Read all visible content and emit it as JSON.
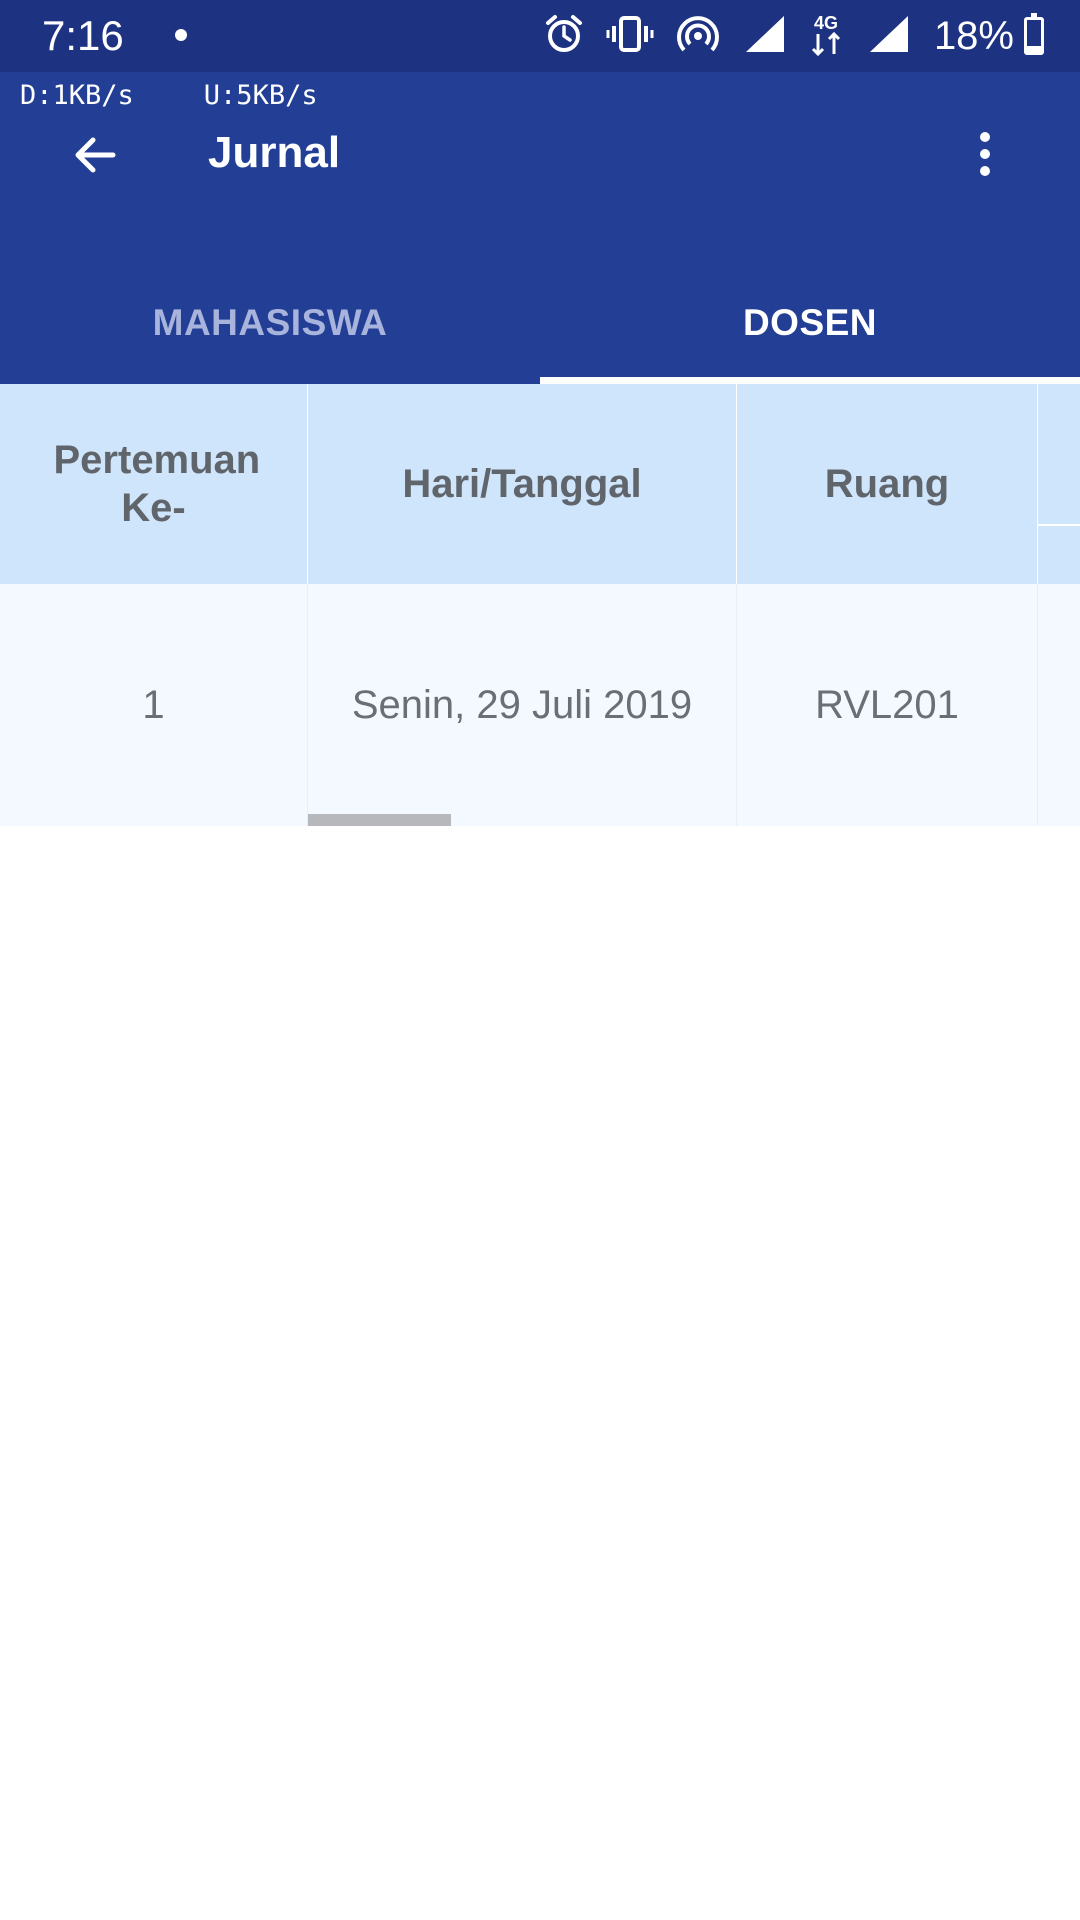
{
  "status_bar": {
    "time": "7:16",
    "network_type": "4G",
    "battery_percent_text": "18%",
    "battery_level": 0.18,
    "icons": [
      "alarm-icon",
      "vibrate-icon",
      "hotspot-icon",
      "signal-icon",
      "data-4g-icon",
      "signal-icon",
      "battery-icon"
    ]
  },
  "net_speed": {
    "download": "D:1KB/s",
    "upload": "U:5KB/s"
  },
  "app_bar": {
    "title": "Jurnal",
    "back_icon": "arrow-back-icon",
    "menu_icon": "more-vert-icon"
  },
  "tabs": [
    {
      "label": "MAHASISWA",
      "active": false
    },
    {
      "label": "DOSEN",
      "active": true
    }
  ],
  "table": {
    "columns": [
      "Pertemuan Ke-",
      "Hari/Tanggal",
      "Ruang",
      ""
    ],
    "rows": [
      [
        "1",
        "Senin, 29 Juli 2019",
        "RVL201",
        ""
      ]
    ]
  },
  "colors": {
    "status_bar": "#1e3282",
    "app_bar": "#233f95",
    "header_row": "#cfe5fb",
    "body_row": "#f3f9fe",
    "inactive_tab_text": "#a8b4dc"
  }
}
